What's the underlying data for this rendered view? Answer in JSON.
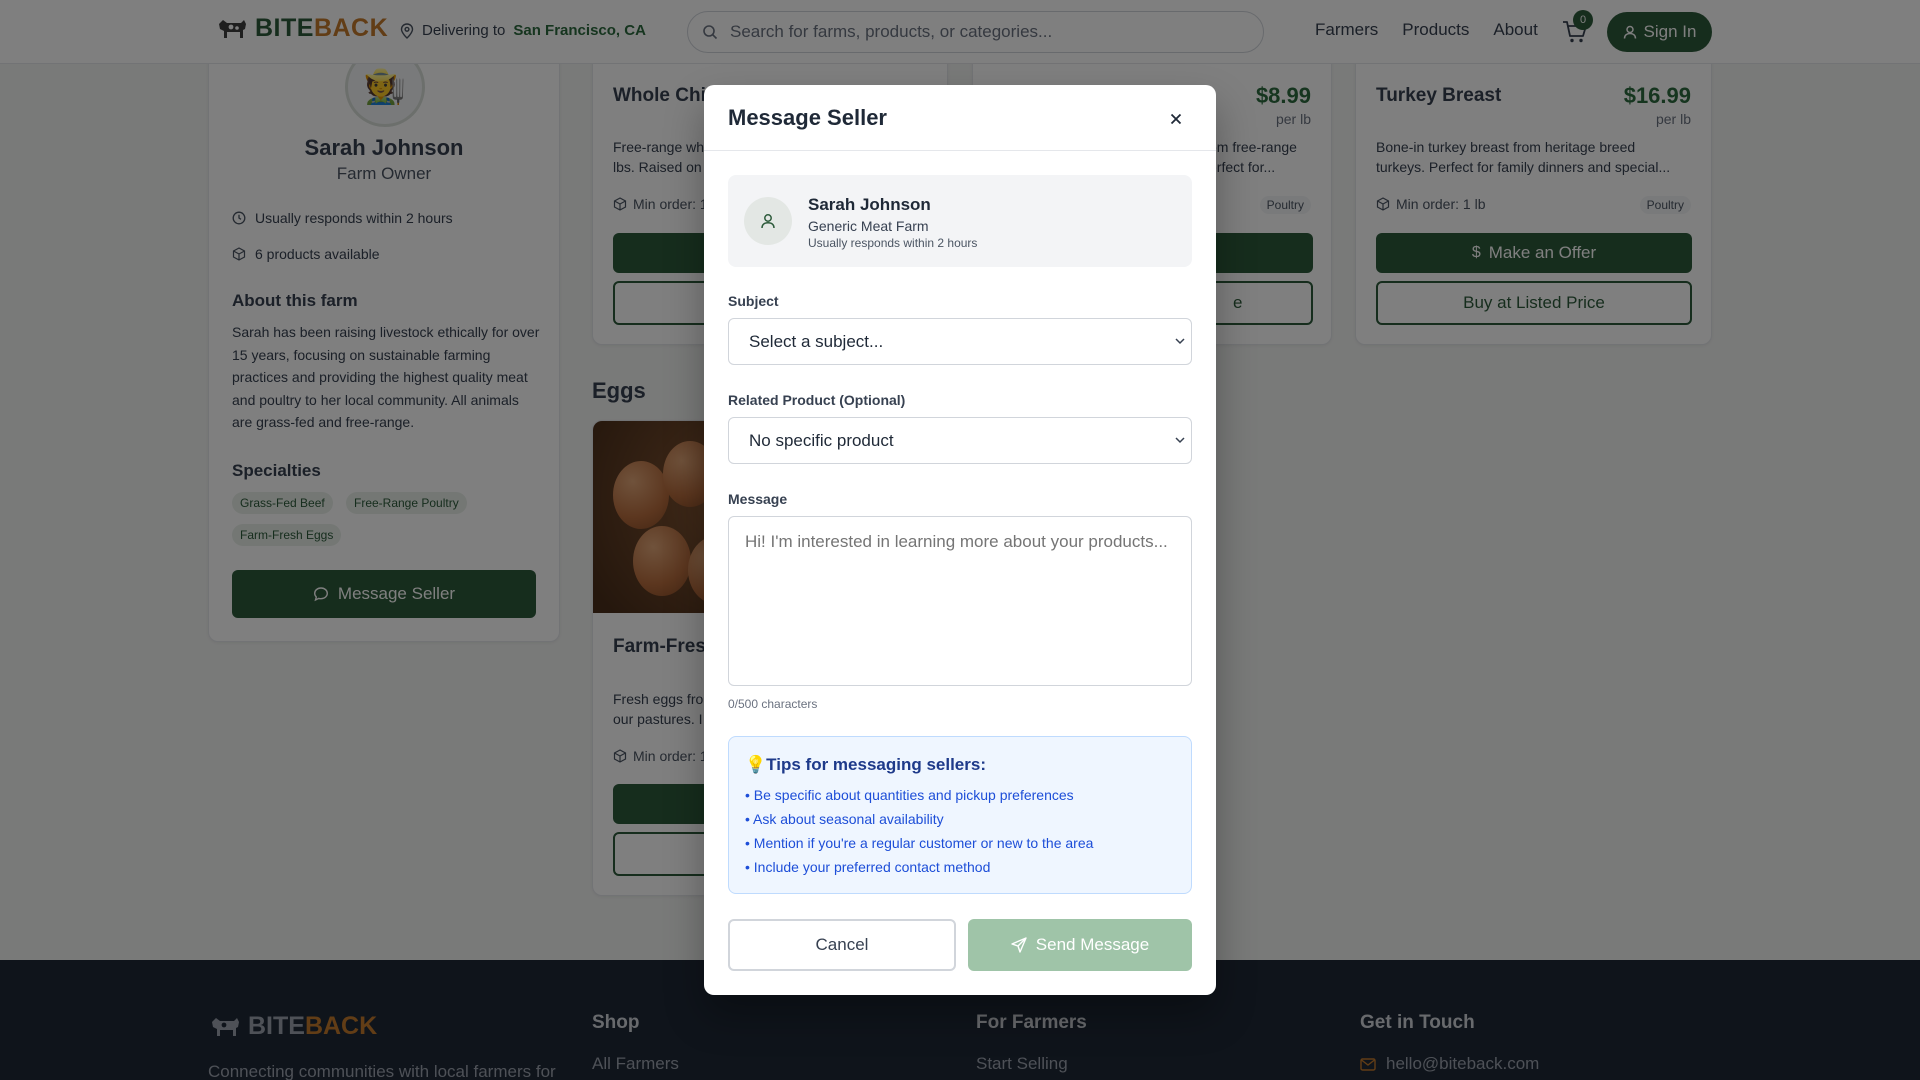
{
  "header": {
    "logo_bite": "BITE",
    "logo_back": "BACK",
    "delivering_label": "Delivering to",
    "city": "San Francisco, CA",
    "search_placeholder": "Search for farms, products, or categories...",
    "nav": [
      "Farmers",
      "Products",
      "About"
    ],
    "cart_count": "0",
    "signin_label": "Sign In"
  },
  "farmer": {
    "avatar_emoji": "🧑‍🌾",
    "name": "Sarah Johnson",
    "role": "Farm Owner",
    "responds": "Usually responds within 2 hours",
    "products_available": "6 products available",
    "about_heading": "About this farm",
    "about_text": "Sarah has been raising livestock ethically for over 15 years, focusing on sustainable farming practices and providing the highest quality meat and poultry to her local community. All animals are grass-fed and free-range.",
    "specialties_heading": "Specialties",
    "specialties": [
      "Grass-Fed Beef",
      "Free-Range Poultry",
      "Farm-Fresh Eggs"
    ],
    "message_button": "Message Seller"
  },
  "products": {
    "whole_chicken": {
      "title": "Whole Chic",
      "desc_line1": "Free-range wh",
      "desc_line2": "lbs. Raised on",
      "min_order": "Min order: 1"
    },
    "middle": {
      "price": "$8.99",
      "unit": "per lb",
      "desc_line1": "om free-range",
      "desc_line2": "erfect for...",
      "category": "Poultry",
      "buy_label": "e"
    },
    "turkey": {
      "title": "Turkey Breast",
      "price": "$16.99",
      "unit": "per lb",
      "desc_line1": "Bone-in turkey breast from heritage breed",
      "desc_line2": "turkeys. Perfect for family dinners and special...",
      "min_order": "Min order: 1 lb",
      "category": "Poultry",
      "offer_label": "Make an Offer",
      "buy_label": "Buy at Listed Price"
    },
    "eggs_heading": "Eggs",
    "eggs": {
      "title": "Farm-Fresh",
      "desc_line1": "Fresh eggs fro",
      "desc_line2": "our pastures. I",
      "min_order": "Min order: 1"
    }
  },
  "footer": {
    "logo_bite": "BITE",
    "logo_back": "BACK",
    "tagline": "Connecting communities with local farmers for",
    "shop_heading": "Shop",
    "shop_link": "All Farmers",
    "farmers_heading": "For Farmers",
    "farmers_link": "Start Selling",
    "contact_heading": "Get in Touch",
    "contact_email": "hello@biteback.com"
  },
  "modal": {
    "title": "Message Seller",
    "seller_name": "Sarah Johnson",
    "seller_farm": "Generic Meat Farm",
    "seller_responds": "Usually responds within 2 hours",
    "subject_label": "Subject",
    "subject_value": "Select a subject...",
    "product_label": "Related Product (Optional)",
    "product_value": "No specific product",
    "message_label": "Message",
    "message_placeholder": "Hi! I'm interested in learning more about your products...",
    "char_count": "0/500 characters",
    "tips_title": "💡Tips for messaging sellers:",
    "tips": [
      "• Be specific about quantities and pickup preferences",
      "• Ask about seasonal availability",
      "• Mention if you're a regular customer or new to the area",
      "• Include your preferred contact method"
    ],
    "cancel_label": "Cancel",
    "send_label": "Send Message"
  },
  "colors": {
    "brand_green": "#2c5a3a",
    "brand_orange": "#c47a2c",
    "price_green": "#2c6b3f",
    "send_disabled": "#9fc4a8",
    "tips_bg": "#eff6ff"
  }
}
